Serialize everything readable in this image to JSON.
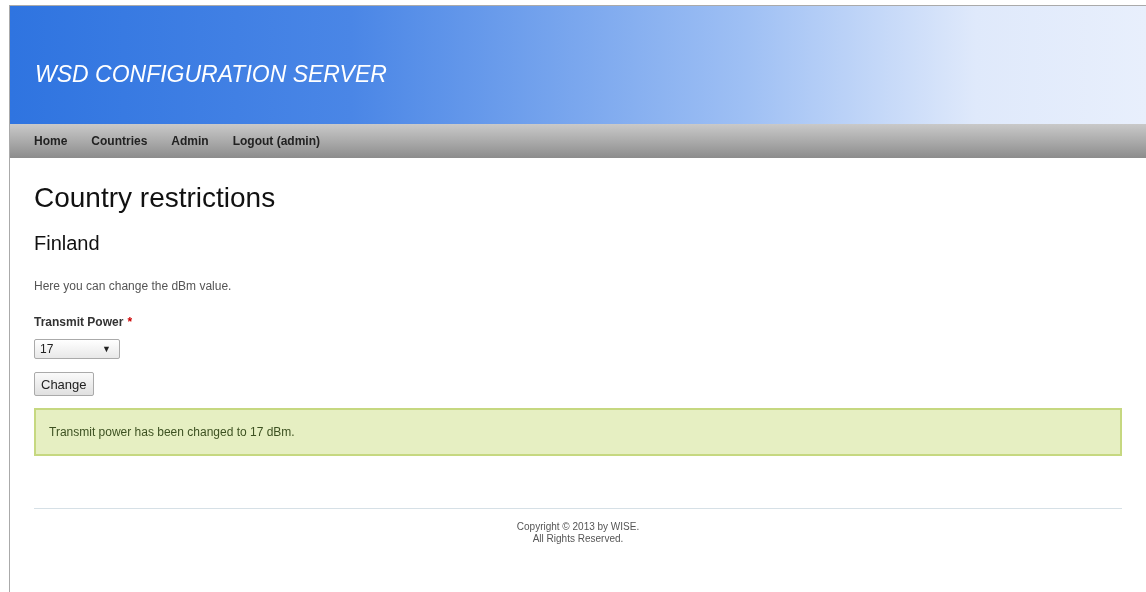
{
  "header": {
    "title": "WSD CONFIGURATION SERVER"
  },
  "nav": [
    {
      "label": "Home"
    },
    {
      "label": "Countries"
    },
    {
      "label": "Admin"
    },
    {
      "label": "Logout (admin)"
    }
  ],
  "page": {
    "title": "Country restrictions",
    "subtitle": "Finland",
    "intro": "Here you can change the dBm value."
  },
  "form": {
    "label": "Transmit Power",
    "required_mark": "*",
    "select_value": "17",
    "select_arrow": "▼",
    "button": "Change"
  },
  "message": "Transmit power has been changed to 17 dBm.",
  "footer": [
    "Copyright © 2013 by WISE.",
    "All Rights Reserved."
  ]
}
